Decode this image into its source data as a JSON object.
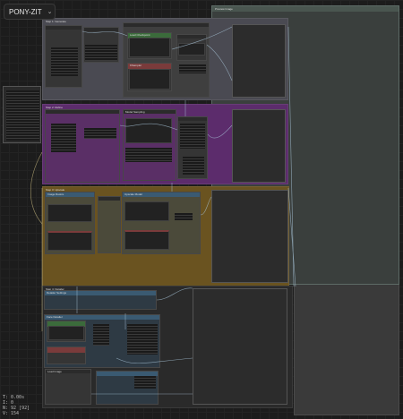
{
  "workflow": {
    "name": "PONY-ZIT",
    "chevron_icon": "chevron-down-icon"
  },
  "groups": [
    {
      "title": "Step 1: Generate"
    },
    {
      "title": "Step 2: Refine"
    },
    {
      "title": "Step 3: Upscale"
    },
    {
      "title": "Step 4: Detailer"
    }
  ],
  "nodes": {
    "g1_green": "Load Checkpoint",
    "g1_red": "KSampler",
    "g2_main": "Model Sampling",
    "g3_a": "Image Resize",
    "g3_b": "Upscale Model",
    "g4_a": "Detailer Settings",
    "g4_b": "Face Detailer",
    "g4_c": "Load Image",
    "big_panel_title": "Preview Image"
  },
  "status": {
    "line1": "T: 0.00s",
    "line2": "I: 0",
    "line3": "N: 92 [92]",
    "line4": "V: 154"
  },
  "colors": {
    "group1": "#4a4a52",
    "group2": "#5c2c6c",
    "group3": "#6a5320",
    "group4": "#2a2a2a",
    "link": "#a8c4d8"
  }
}
